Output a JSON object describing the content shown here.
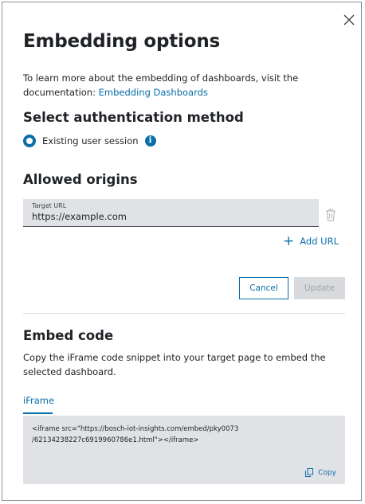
{
  "dialog": {
    "title": "Embedding options",
    "intro_text": "To learn more about the embedding of dashboards, visit the documentation: ",
    "intro_link": "Embedding Dashboards"
  },
  "auth": {
    "heading": "Select authentication method",
    "option_label": "Existing user session",
    "info_glyph": "i"
  },
  "origins": {
    "heading": "Allowed origins",
    "field_label": "Target URL",
    "field_value": "https://example.com",
    "add_url_label": "Add URL",
    "add_glyph": "+"
  },
  "actions": {
    "cancel_label": "Cancel",
    "update_label": "Update"
  },
  "embed": {
    "heading": "Embed code",
    "description": "Copy the iFrame code snippet into your target page to embed the selected dashboard.",
    "tab_label": "iFrame",
    "code_line1": "<iframe src=\"https://bosch-iot-insights.com/embed/pky0073",
    "code_line2": "/62134238227c6919960786e1.html\"></iframe>",
    "copy_label": "Copy"
  },
  "colors": {
    "accent": "#0a6ea8",
    "field_bg": "#e0e2e5",
    "disabled_bg": "#d8dadd"
  }
}
